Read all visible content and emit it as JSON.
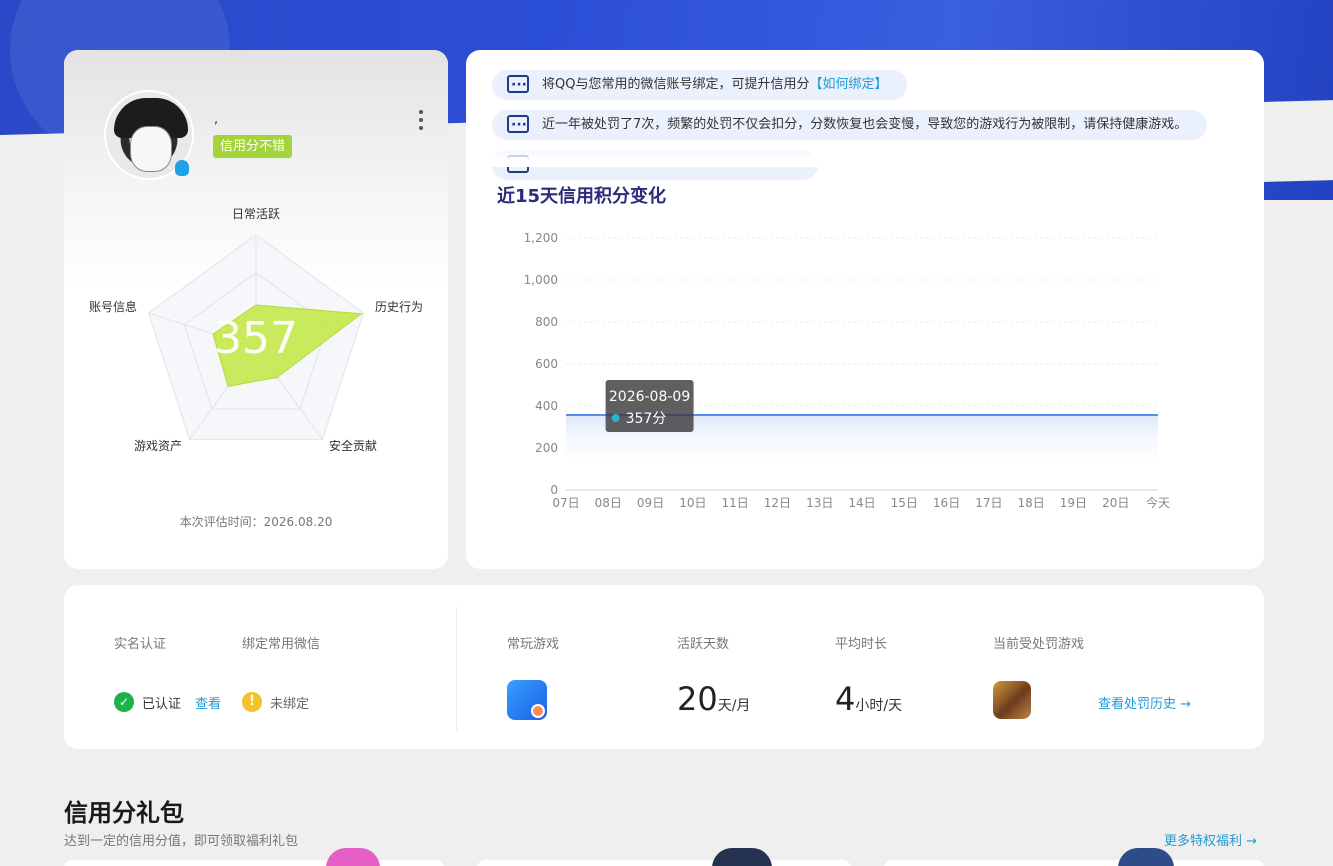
{
  "profile": {
    "nickname": ",",
    "credit_badge": "信用分不错",
    "score": "357",
    "radar_labels": {
      "daily": "日常活跃",
      "history": "历史行为",
      "security": "安全贡献",
      "assets": "游戏资产",
      "account": "账号信息"
    },
    "radar_values": {
      "daily": 0.38,
      "history": 0.98,
      "security": 0.32,
      "assets": 0.42,
      "account": 0.4
    },
    "eval_time_label": "本次评估时间：",
    "eval_time": "2026.08.20"
  },
  "tips": [
    {
      "text": "将QQ与您常用的微信账号绑定，可提升信用分",
      "link": "【如何绑定】"
    },
    {
      "text": "近一年被处罚了7次，频繁的处罚不仅会扣分，分数恢复也会变慢，导致您的游戏行为被限制，请保持健康游戏。",
      "link": ""
    }
  ],
  "chart_title": "近15天信用积分变化",
  "chart_data": {
    "type": "area",
    "title": "近15天信用积分变化",
    "categories": [
      "07日",
      "08日",
      "09日",
      "10日",
      "11日",
      "12日",
      "13日",
      "14日",
      "15日",
      "16日",
      "17日",
      "18日",
      "19日",
      "20日",
      "今天"
    ],
    "series": [
      {
        "values": [
          357,
          357,
          357,
          357,
          357,
          357,
          357,
          357,
          357,
          357,
          357,
          357,
          357,
          357,
          357
        ]
      }
    ],
    "ylim": [
      0,
      1200
    ],
    "yticks": [
      "0",
      "200",
      "400",
      "600",
      "800",
      "1,000",
      "1,200"
    ],
    "grid": true,
    "tooltip": {
      "date": "2026-08-09",
      "value": "357分"
    },
    "colors": {
      "line": "#5b8def",
      "area": "#dde7fb"
    }
  },
  "stats": {
    "real_name_label": "实名认证",
    "real_name_status": "已认证",
    "real_name_link": "查看",
    "wechat_label": "绑定常用微信",
    "wechat_status": "未绑定",
    "frequent_game_label": "常玩游戏",
    "active_days_label": "活跃天数",
    "active_days_value": "20",
    "active_days_unit": "天/月",
    "avg_time_label": "平均时长",
    "avg_time_value": "4",
    "avg_time_unit": "小时/天",
    "penalty_game_label": "当前受处罚游戏",
    "penalty_link": "查看处罚历史 →"
  },
  "gift": {
    "title": "信用分礼包",
    "subtitle": "达到一定的信用分值，即可领取福利礼包",
    "more": "更多特权福利 →"
  },
  "icons": {
    "tip": "message-icon",
    "ok": "check-circle-icon",
    "warn": "exclamation-circle-icon",
    "more": "more-vertical-icon",
    "qq": "qq-icon"
  }
}
